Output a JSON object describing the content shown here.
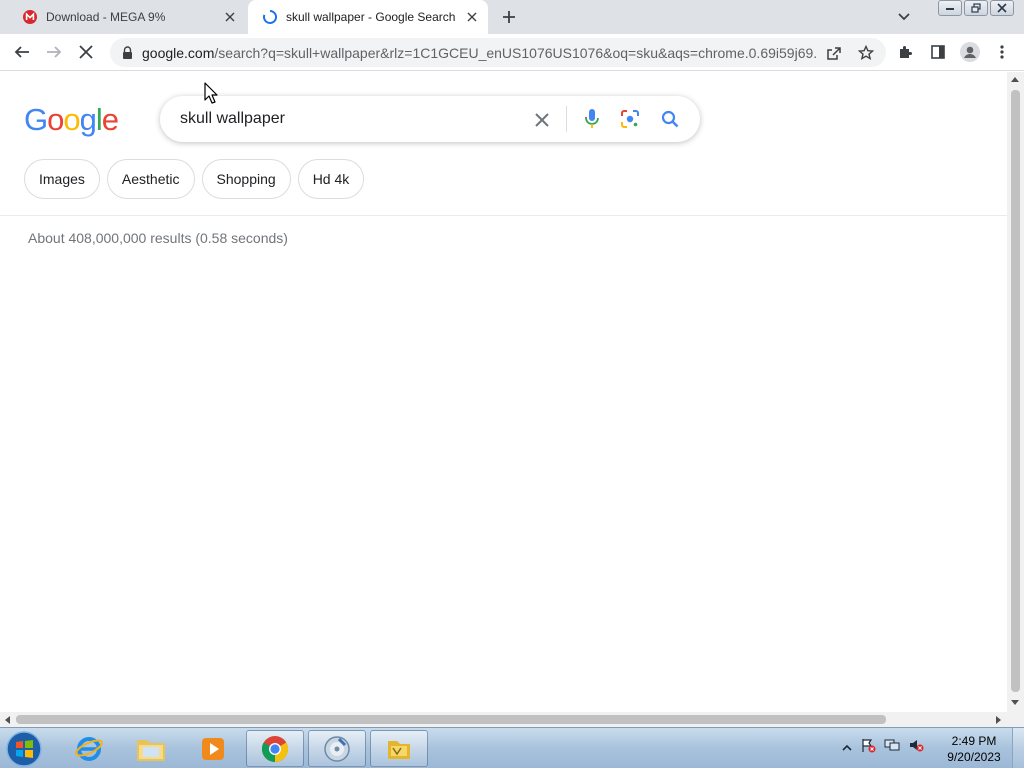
{
  "tabs": [
    {
      "title": "Download - MEGA 9%",
      "favicon": "mega-icon"
    },
    {
      "title": "skull wallpaper - Google Search",
      "favicon": "loading-spinner-icon"
    }
  ],
  "omnibox": {
    "url_host": "google.com",
    "url_rest": "/search?q=skull+wallpaper&rlz=1C1GCEU_enUS1076US1076&oq=sku&aqs=chrome.0.69i59j69..."
  },
  "search": {
    "logo": "Google",
    "query": "skull wallpaper"
  },
  "chips": [
    "Images",
    "Aesthetic",
    "Shopping",
    "Hd 4k"
  ],
  "result_stats": "About 408,000,000 results (0.58 seconds)",
  "taskbar": {
    "apps": [
      "internet-explorer",
      "windows-explorer",
      "media-player",
      "chrome",
      "media-center",
      "app-folder"
    ],
    "clock_time": "2:49 PM",
    "clock_date": "9/20/2023"
  },
  "colors": {
    "google_blue": "#4285F4",
    "google_red": "#EA4335",
    "google_yellow": "#FBBC05",
    "google_green": "#34A853",
    "mega_red": "#D9272E"
  }
}
